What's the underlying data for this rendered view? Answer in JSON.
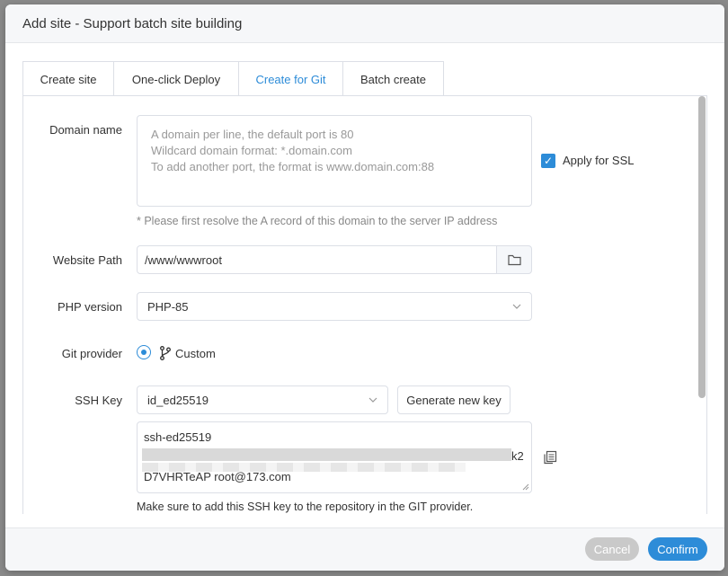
{
  "dialog": {
    "title": "Add site - Support batch site building"
  },
  "tabs": [
    {
      "label": "Create site",
      "active": false
    },
    {
      "label": "One-click Deploy",
      "active": false
    },
    {
      "label": "Create for Git",
      "active": true
    },
    {
      "label": "Batch create",
      "active": false
    }
  ],
  "form": {
    "domain": {
      "label": "Domain name",
      "placeholder_lines": [
        "A domain per line, the default port is 80",
        "Wildcard domain format: *.domain.com",
        "To add another port, the format is www.domain.com:88"
      ],
      "hint": "* Please first resolve the A record of this domain to the server IP address",
      "ssl_label": "Apply for SSL",
      "ssl_checked": true
    },
    "website_path": {
      "label": "Website Path",
      "value": "/www/wwwroot",
      "browse_icon": "folder-icon"
    },
    "php": {
      "label": "PHP version",
      "selected": "PHP-85"
    },
    "git": {
      "label": "Git provider",
      "option": "Custom",
      "option_icon": "git-branch-icon",
      "selected": true
    },
    "ssh": {
      "label": "SSH Key",
      "selected": "id_ed25519",
      "generate_label": "Generate new key",
      "key_line1": "ssh-ed25519",
      "key_line2_suffix": "k2",
      "key_line3": "D7VHRTeAP root@173.com",
      "copy_icon": "copy-icon",
      "note": "Make sure to add this SSH key to the repository in the GIT provider."
    }
  },
  "footer": {
    "cancel_label": "Cancel",
    "confirm_label": "Confirm"
  },
  "colors": {
    "accent": "#2d8cd8",
    "disabled": "#c9c9c9",
    "border": "#dcdfe6"
  }
}
